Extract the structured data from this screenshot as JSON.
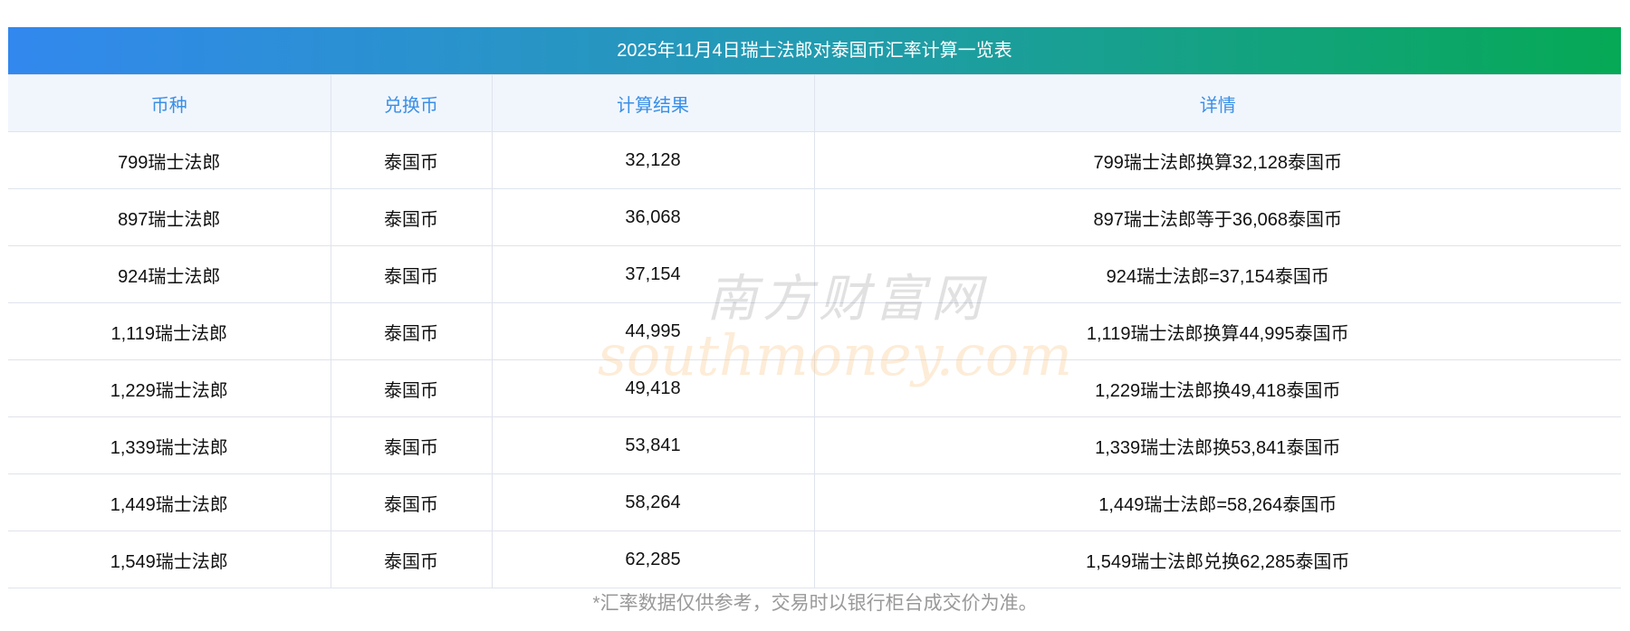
{
  "title": "2025年11月4日瑞士法郎对泰国币汇率计算一览表",
  "columns": [
    "币种",
    "兑换币",
    "计算结果",
    "详情"
  ],
  "rows": [
    [
      "799瑞士法郎",
      "泰国币",
      "32,128",
      "799瑞士法郎换算32,128泰国币"
    ],
    [
      "897瑞士法郎",
      "泰国币",
      "36,068",
      "897瑞士法郎等于36,068泰国币"
    ],
    [
      "924瑞士法郎",
      "泰国币",
      "37,154",
      "924瑞士法郎=37,154泰国币"
    ],
    [
      "1,119瑞士法郎",
      "泰国币",
      "44,995",
      "1,119瑞士法郎换算44,995泰国币"
    ],
    [
      "1,229瑞士法郎",
      "泰国币",
      "49,418",
      "1,229瑞士法郎换49,418泰国币"
    ],
    [
      "1,339瑞士法郎",
      "泰国币",
      "53,841",
      "1,339瑞士法郎换53,841泰国币"
    ],
    [
      "1,449瑞士法郎",
      "泰国币",
      "58,264",
      "1,449瑞士法郎=58,264泰国币"
    ],
    [
      "1,549瑞士法郎",
      "泰国币",
      "62,285",
      "1,549瑞士法郎兑换62,285泰国币"
    ]
  ],
  "footer": "*汇率数据仅供参考，交易时以银行柜台成交价为准。",
  "watermark": {
    "cn": "南方财富网",
    "en": "southmoney.com"
  }
}
